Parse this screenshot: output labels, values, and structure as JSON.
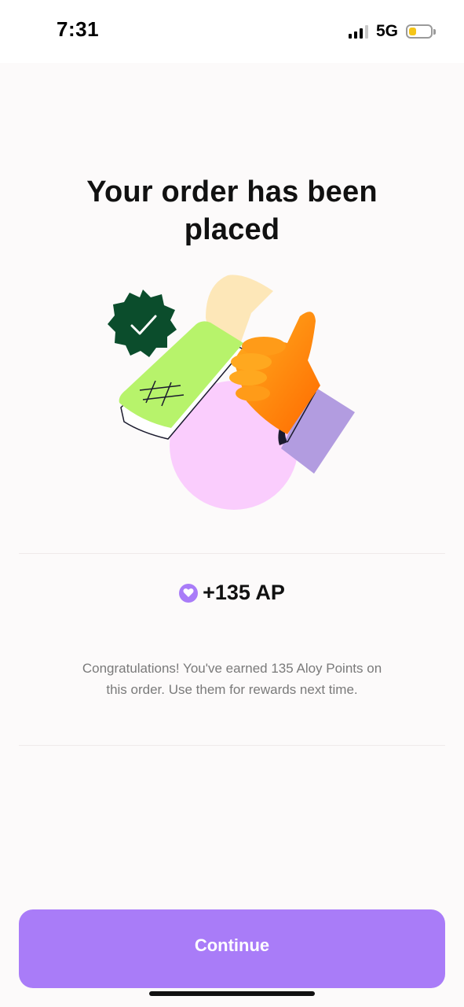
{
  "status_bar": {
    "time": "7:31",
    "network": "5G",
    "battery_level": 0.35,
    "battery_color": "#f5c518"
  },
  "page": {
    "title": "Your order has been placed"
  },
  "illustration": {
    "icon": "thumbs-up-receipt-illustration",
    "colors": {
      "badge": "#0b4d2c",
      "receipt": "#b7f36b",
      "paper": "#fde7b8",
      "circle": "#facdfd",
      "hand": "#ff8c1a",
      "sleeve": "#b29ce0"
    }
  },
  "points": {
    "icon": "heart-icon",
    "value": "+135 AP",
    "color": "#a97cf8"
  },
  "message": "Congratulations! You've earned 135 Aloy Points on this order. Use them for rewards next time.",
  "actions": {
    "continue_label": "Continue",
    "accent": "#a97cf8"
  }
}
